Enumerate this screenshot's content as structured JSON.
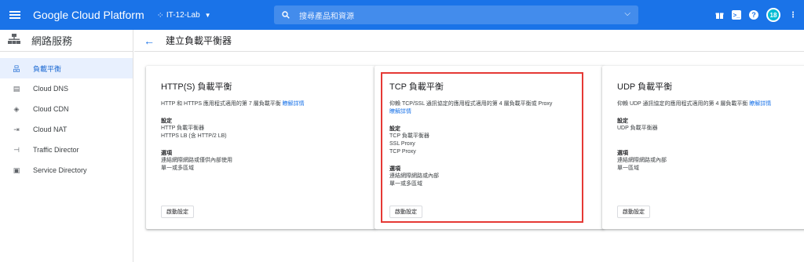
{
  "topbar": {
    "brand": "Google Cloud Platform",
    "project": "IT-12-Lab",
    "search_placeholder": "搜尋產品和資源",
    "avatar_text": "18",
    "icons": [
      "gift-icon",
      "terminal-icon",
      "help-icon",
      "avatar",
      "more-vert-icon"
    ]
  },
  "sidebar": {
    "title": "網路服務",
    "items": [
      {
        "label": "負載平衡",
        "icon": "load-balancing-icon"
      },
      {
        "label": "Cloud DNS",
        "icon": "dns-icon"
      },
      {
        "label": "Cloud CDN",
        "icon": "cdn-icon"
      },
      {
        "label": "Cloud NAT",
        "icon": "nat-icon"
      },
      {
        "label": "Traffic Director",
        "icon": "traffic-director-icon"
      },
      {
        "label": "Service Directory",
        "icon": "service-directory-icon"
      }
    ]
  },
  "header": {
    "title": "建立負載平衡器"
  },
  "cards": [
    {
      "title": "HTTP(S) 負載平衡",
      "desc": "HTTP 和 HTTPS 應用程式適用的第 7 層負載平衡",
      "link": "瞭解詳情",
      "config_label": "設定",
      "config_lines": [
        "HTTP 負載平衡器",
        "HTTPS LB (含 HTTP/2 LB)"
      ],
      "options_label": "選項",
      "options_lines": [
        "連結網際網路或僅供內部使用",
        "單一或多區域"
      ],
      "button": "啟動設定"
    },
    {
      "title": "TCP 負載平衡",
      "desc": "仰賴 TCP/SSL 通訊協定的應用程式適用的第 4 層負載平衡或 Proxy",
      "link": "瞭解詳情",
      "config_label": "設定",
      "config_lines": [
        "TCP 負載平衡器",
        "SSL Proxy",
        "TCP Proxy"
      ],
      "options_label": "選項",
      "options_lines": [
        "連結網際網路或內部",
        "單一或多區域"
      ],
      "button": "啟動設定"
    },
    {
      "title": "UDP 負載平衡",
      "desc": "仰賴 UDP 通訊協定的應用程式適用的第 4 層負載平衡",
      "link": "瞭解詳情",
      "config_label": "設定",
      "config_lines": [
        "UDP 負載平衡器"
      ],
      "options_label": "選項",
      "options_lines": [
        "連結網際網路或內部",
        "單一區域"
      ],
      "button": "啟動設定"
    }
  ],
  "colors": {
    "primary": "#1a73e8",
    "highlight": "#e53935",
    "active_bg": "#e8f0fe"
  }
}
